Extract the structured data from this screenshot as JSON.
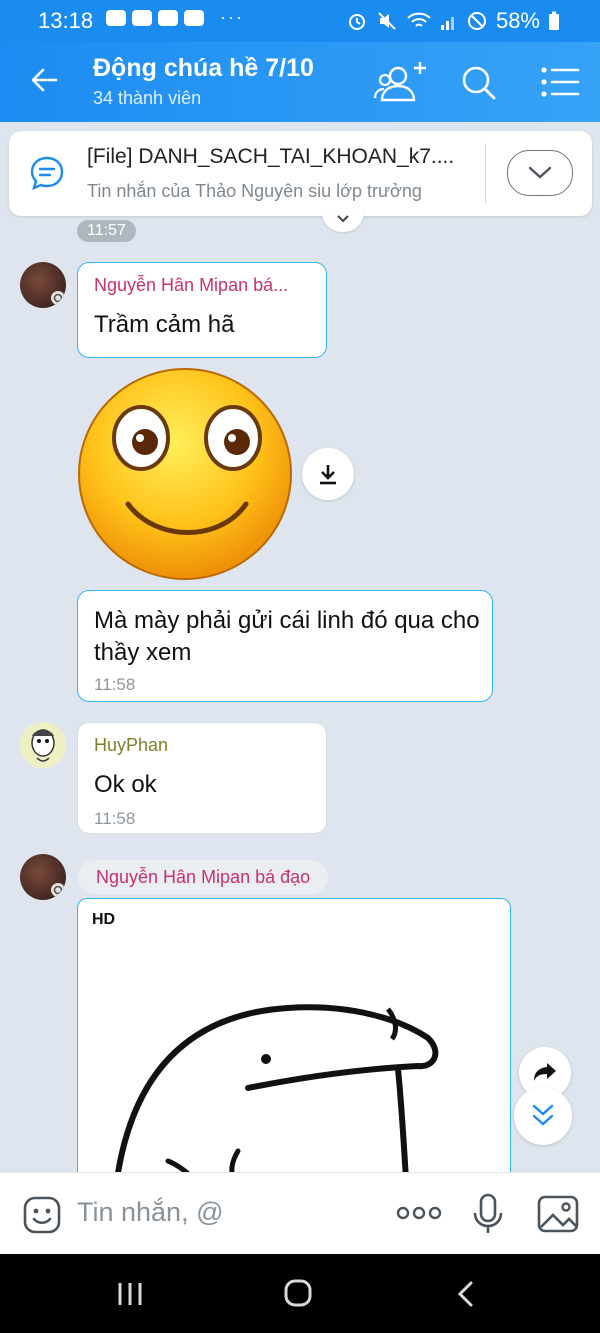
{
  "status_bar": {
    "time": "13:18",
    "dots": "···",
    "battery": "58%"
  },
  "header": {
    "title": "Động chúa hề 7/10",
    "subtitle": "34 thành viên"
  },
  "pinned": {
    "title": "[File] DANH_SACH_TAI_KHOAN_k7....",
    "subtitle": "Tin nhắn của Thảo Nguyên siu lớp trưởng"
  },
  "messages": {
    "time_chip": "11:57",
    "m1": {
      "sender": "Nguyễn Hân Mipan bá...",
      "text": "Trầm cảm hã"
    },
    "m2": {
      "text": "Mà mày phải gửi cái linh đó qua cho thầy xem",
      "time": "11:58"
    },
    "m3": {
      "sender": "HuyPhan",
      "text": "Ok ok",
      "time": "11:58"
    },
    "m4": {
      "sender": "Nguyễn Hân Mipan bá đạo",
      "image_badge": "HD"
    }
  },
  "input": {
    "placeholder": "Tin nhắn, @",
    "more": "ooo"
  },
  "colors": {
    "brand": "#1a8cf0",
    "bubble_border": "#30b6f0",
    "sender_pink": "#c6336f",
    "sender_olive": "#7f7f2a"
  },
  "icons": [
    "back-arrow-icon",
    "add-member-icon",
    "search-icon",
    "menu-icon",
    "chat-bubble-icon",
    "chevron-down-icon",
    "download-icon",
    "forward-icon",
    "scroll-down-icon",
    "sticker-icon",
    "mic-icon",
    "image-icon",
    "nav-recents-icon",
    "nav-home-icon",
    "nav-back-icon"
  ]
}
